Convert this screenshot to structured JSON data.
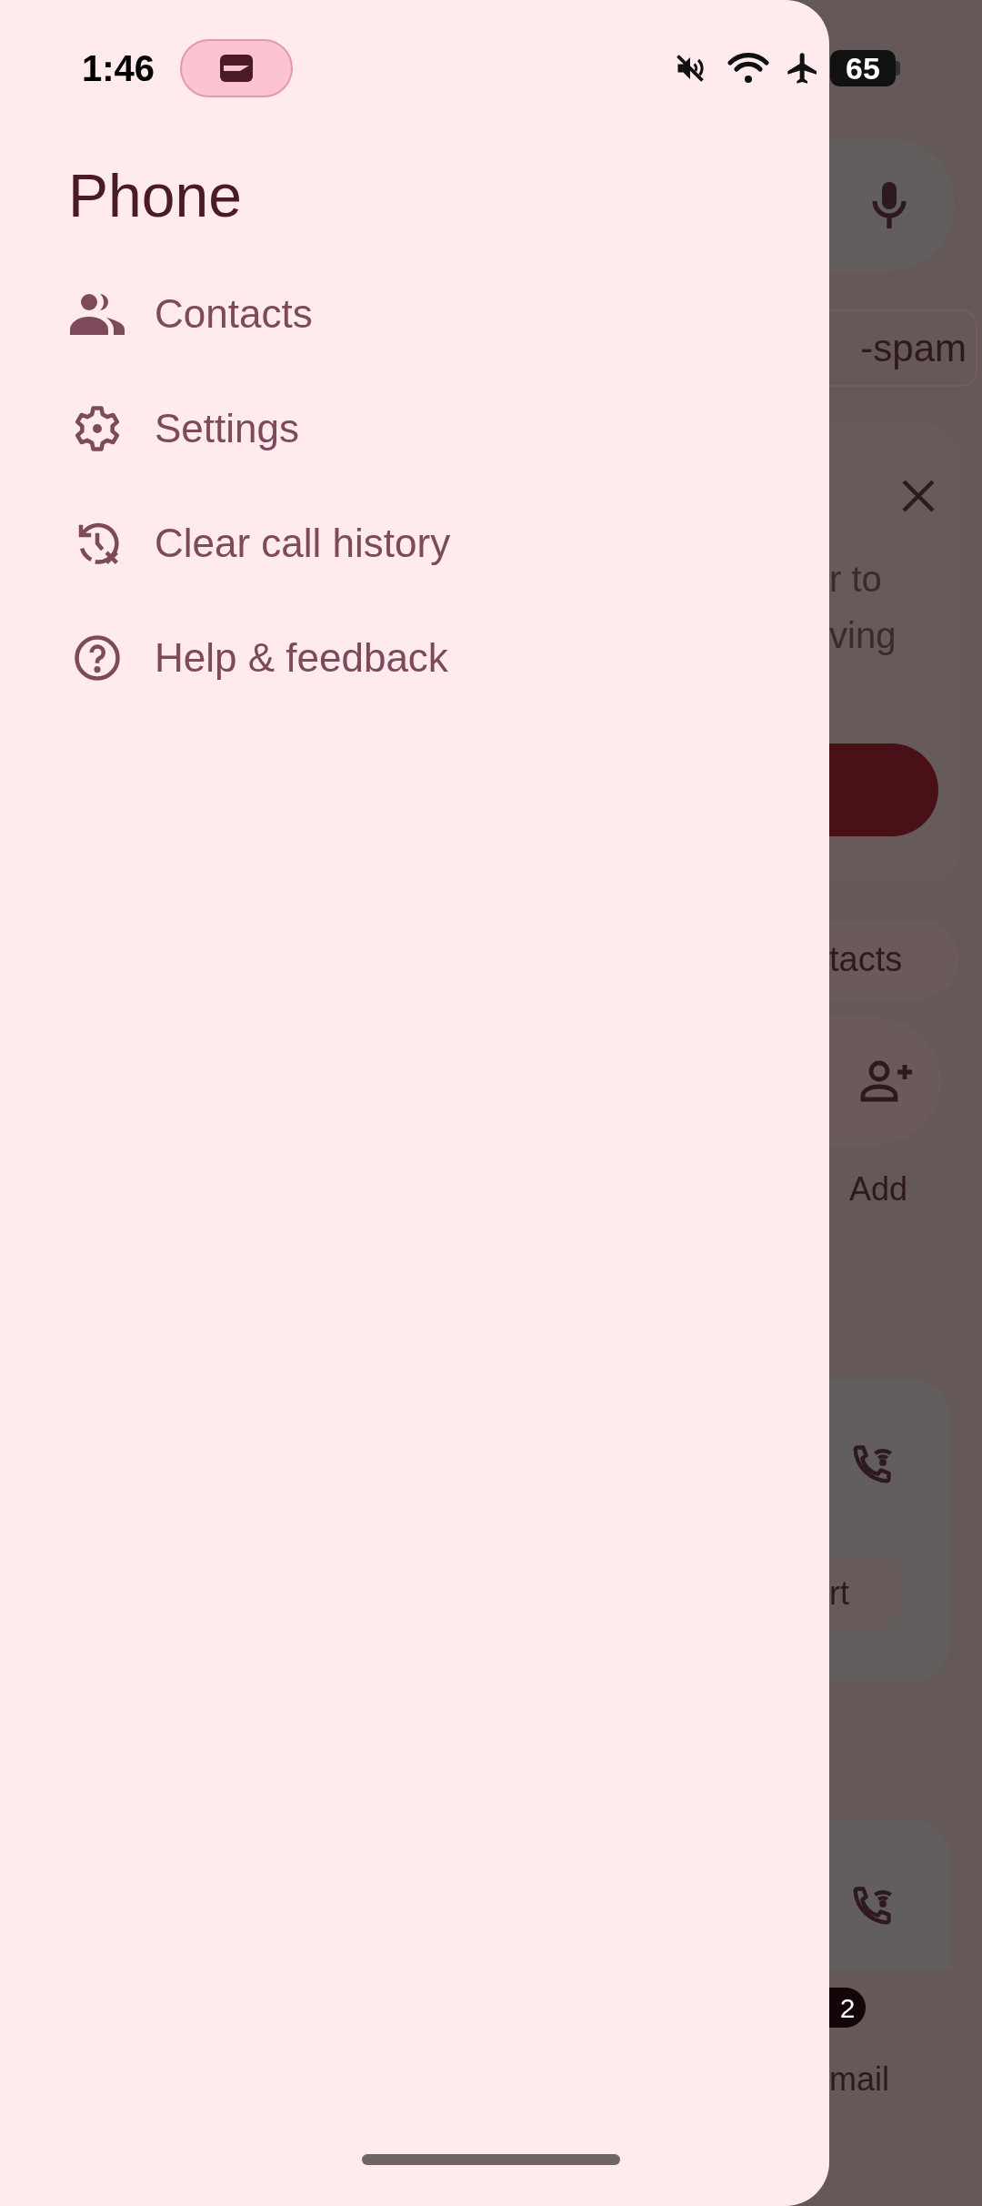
{
  "status_bar": {
    "time": "1:46",
    "battery": "65"
  },
  "drawer": {
    "title": "Phone",
    "items": [
      {
        "label": "Contacts",
        "kind": "contacts"
      },
      {
        "label": "Settings",
        "kind": "settings"
      },
      {
        "label": "Clear call history",
        "kind": "history"
      },
      {
        "label": "Help & feedback",
        "kind": "help"
      }
    ]
  },
  "background": {
    "filter_chip": "-spam",
    "card_lines": [
      "r to",
      "ving"
    ],
    "contacts_chip": "tacts",
    "add_label": "Add",
    "card_chip": "rt",
    "badge": "2",
    "nav_label": "mail"
  }
}
